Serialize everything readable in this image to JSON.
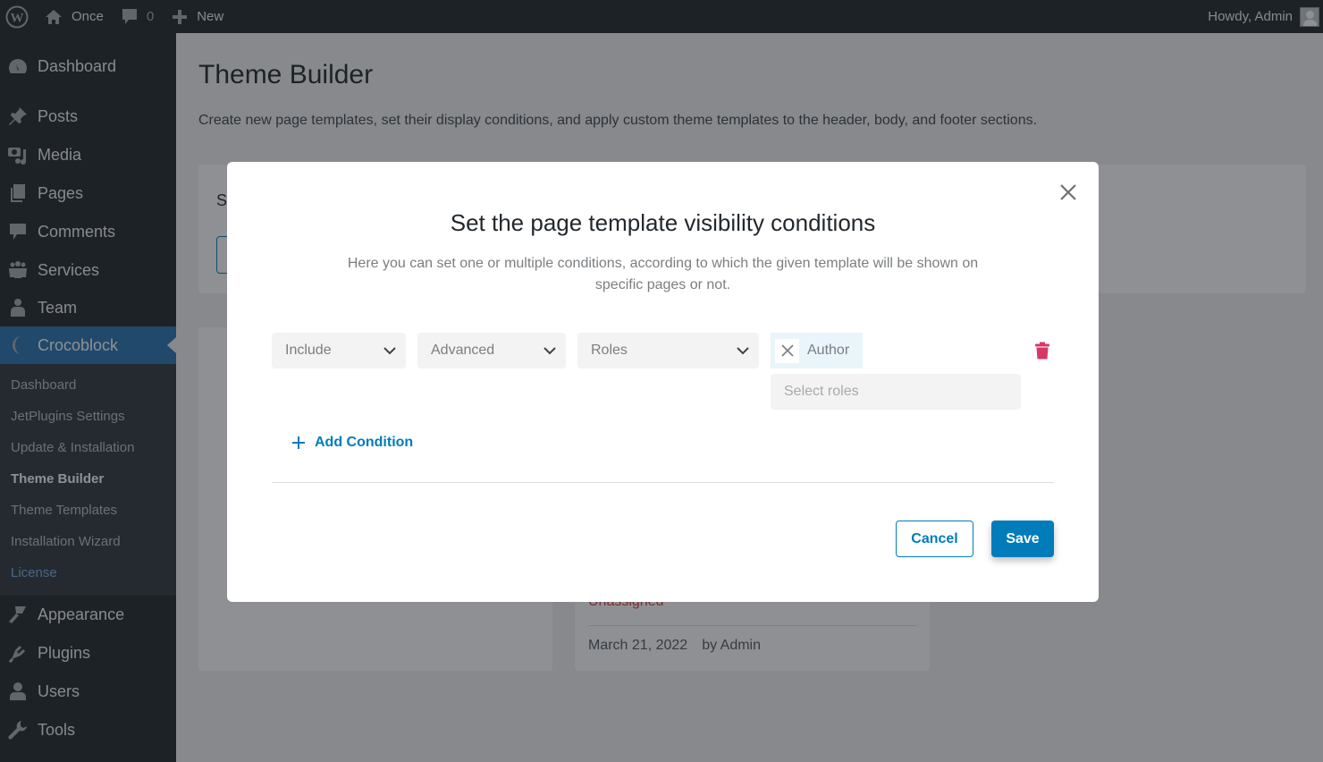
{
  "adminbar": {
    "site_name": "Once",
    "comments_count": "0",
    "new_label": "New",
    "greeting": "Howdy, Admin"
  },
  "sidebar": {
    "items": [
      {
        "label": "Dashboard",
        "icon": "dashboard-icon"
      },
      {
        "label": "Posts",
        "icon": "pin-icon"
      },
      {
        "label": "Media",
        "icon": "media-icon"
      },
      {
        "label": "Pages",
        "icon": "pages-icon"
      },
      {
        "label": "Comments",
        "icon": "comment-icon"
      },
      {
        "label": "Services",
        "icon": "groups-icon"
      },
      {
        "label": "Team",
        "icon": "businessman-icon"
      },
      {
        "label": "Crocoblock",
        "icon": "crocoblock-icon",
        "current": true
      },
      {
        "label": "Appearance",
        "icon": "paintbrush-icon"
      },
      {
        "label": "Plugins",
        "icon": "plugin-icon"
      },
      {
        "label": "Users",
        "icon": "user-icon"
      },
      {
        "label": "Tools",
        "icon": "wrench-icon"
      }
    ],
    "submenu": [
      {
        "label": "Dashboard"
      },
      {
        "label": "JetPlugins Settings"
      },
      {
        "label": "Update & Installation"
      },
      {
        "label": "Theme Builder",
        "active": true
      },
      {
        "label": "Theme Templates"
      },
      {
        "label": "Installation Wizard"
      },
      {
        "label": "License"
      }
    ]
  },
  "main": {
    "title": "Theme Builder",
    "description": "Create new page templates, set their display conditions, and apply custom theme templates to the header, body, and footer sections.",
    "card_top_letter": "S",
    "template_card": {
      "status": "Unassigned",
      "date": "March 21, 2022",
      "author": "by Admin"
    }
  },
  "modal": {
    "title": "Set the page template visibility conditions",
    "description": "Here you can set one or multiple conditions, according to which the given template will be shown on specific pages or not.",
    "condition": {
      "include_value": "Include",
      "group_value": "Advanced",
      "subgroup_value": "Roles",
      "selected_tags": [
        "Author"
      ],
      "roles_placeholder": "Select roles"
    },
    "add_condition_label": "Add Condition",
    "cancel_label": "Cancel",
    "save_label": "Save"
  },
  "colors": {
    "accent": "#007cba",
    "delete": "#d63865",
    "admin_bar": "#1d2327",
    "menu_current": "#2271b1"
  }
}
